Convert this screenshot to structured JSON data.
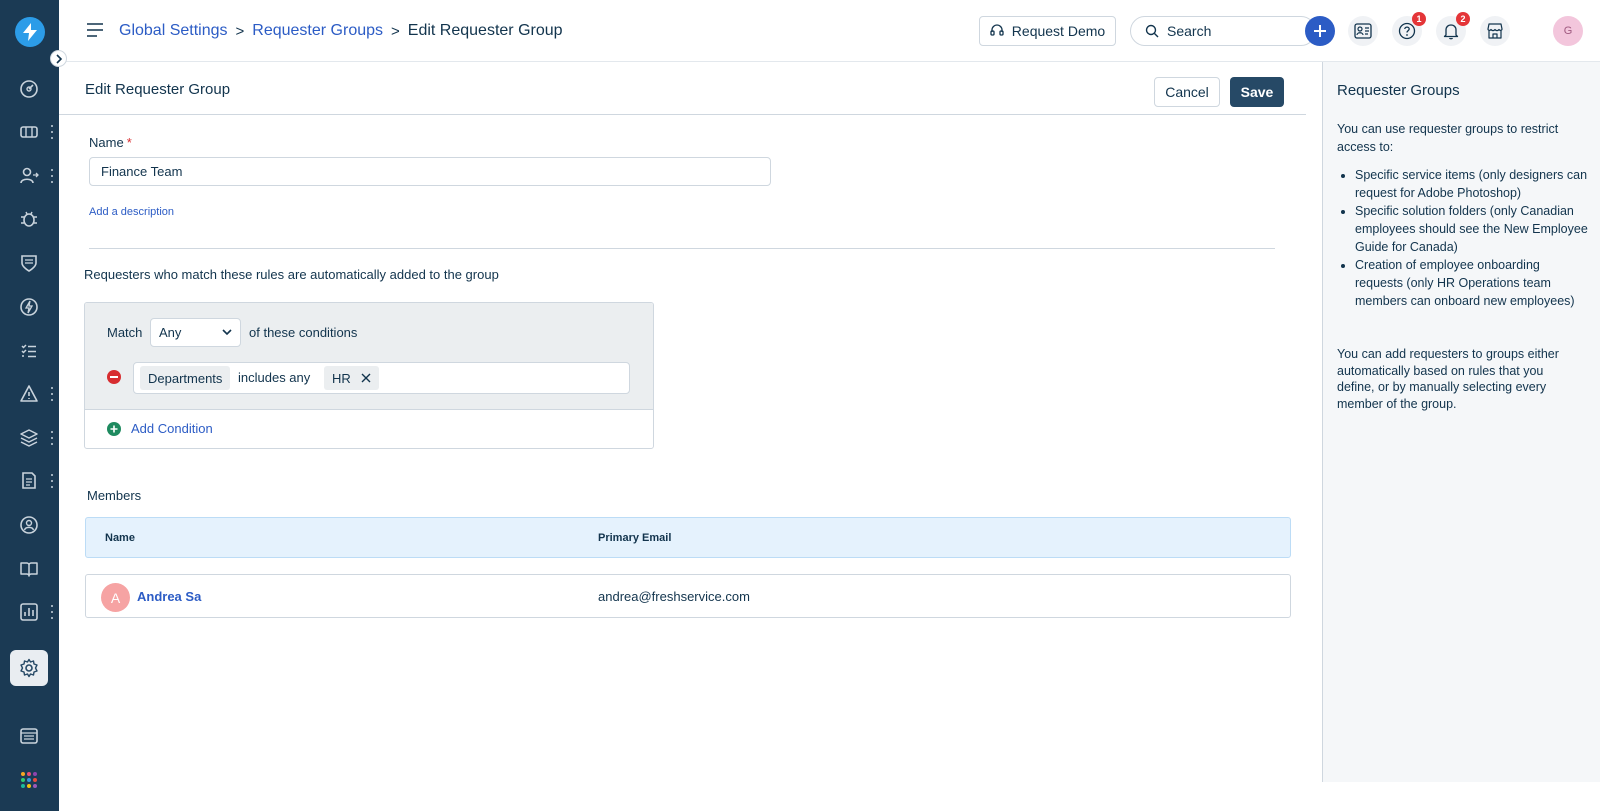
{
  "header": {
    "breadcrumb": {
      "global_settings": "Global Settings",
      "requester_groups": "Requester Groups",
      "current": "Edit Requester Group",
      "separator": ">"
    },
    "request_demo_label": "Request Demo",
    "search_placeholder": "Search",
    "help_badge": "1",
    "notifications_badge": "2",
    "avatar_initial": "G"
  },
  "page": {
    "title": "Edit Requester Group",
    "cancel_label": "Cancel",
    "save_label": "Save"
  },
  "form": {
    "name_label": "Name",
    "required_mark": "*",
    "name_value": "Finance Team",
    "add_description_label": "Add a description"
  },
  "rules": {
    "title": "Requesters who match these rules are automatically added to the group",
    "match_label": "Match",
    "match_value": "Any",
    "conditions_suffix": "of these conditions",
    "condition": {
      "field": "Departments",
      "operator": "includes any",
      "value": "HR"
    },
    "add_condition_label": "Add Condition"
  },
  "members": {
    "title": "Members",
    "columns": [
      "Name",
      "Primary Email"
    ],
    "rows": [
      {
        "initial": "A",
        "name": "Andrea Sa",
        "email": "andrea@freshservice.com"
      }
    ]
  },
  "info_panel": {
    "title": "Requester Groups",
    "intro": "You can use requester groups to restrict access to:",
    "items": [
      "Specific service items (only designers can request for Adobe Photoshop)",
      "Specific solution folders (only Canadian employees should see the New Employee Guide for Canada)",
      "Creation of employee onboarding requests (only HR Operations team members can onboard new employees)"
    ],
    "outro": "You can add requesters to groups either automatically based on rules that you define, or by manually selecting every member of the group."
  },
  "sidebar": {
    "items": [
      {
        "icon": "dashboard-icon"
      },
      {
        "icon": "tickets-icon"
      },
      {
        "icon": "requesters-icon"
      },
      {
        "icon": "problems-icon"
      },
      {
        "icon": "changes-icon"
      },
      {
        "icon": "releases-icon"
      },
      {
        "icon": "tasks-icon"
      },
      {
        "icon": "alerts-icon"
      },
      {
        "icon": "assets-icon"
      },
      {
        "icon": "contracts-icon"
      },
      {
        "icon": "team-icon"
      },
      {
        "icon": "solutions-icon"
      },
      {
        "icon": "reports-icon"
      },
      {
        "icon": "settings-icon"
      },
      {
        "icon": "catalog-icon"
      },
      {
        "icon": "apps-icon"
      }
    ]
  },
  "colors": {
    "sidebar_bg": "#1b3a54",
    "link": "#2c5cc5",
    "primary_button": "#264966",
    "danger": "#d72d30",
    "success": "#1e8a5f"
  }
}
